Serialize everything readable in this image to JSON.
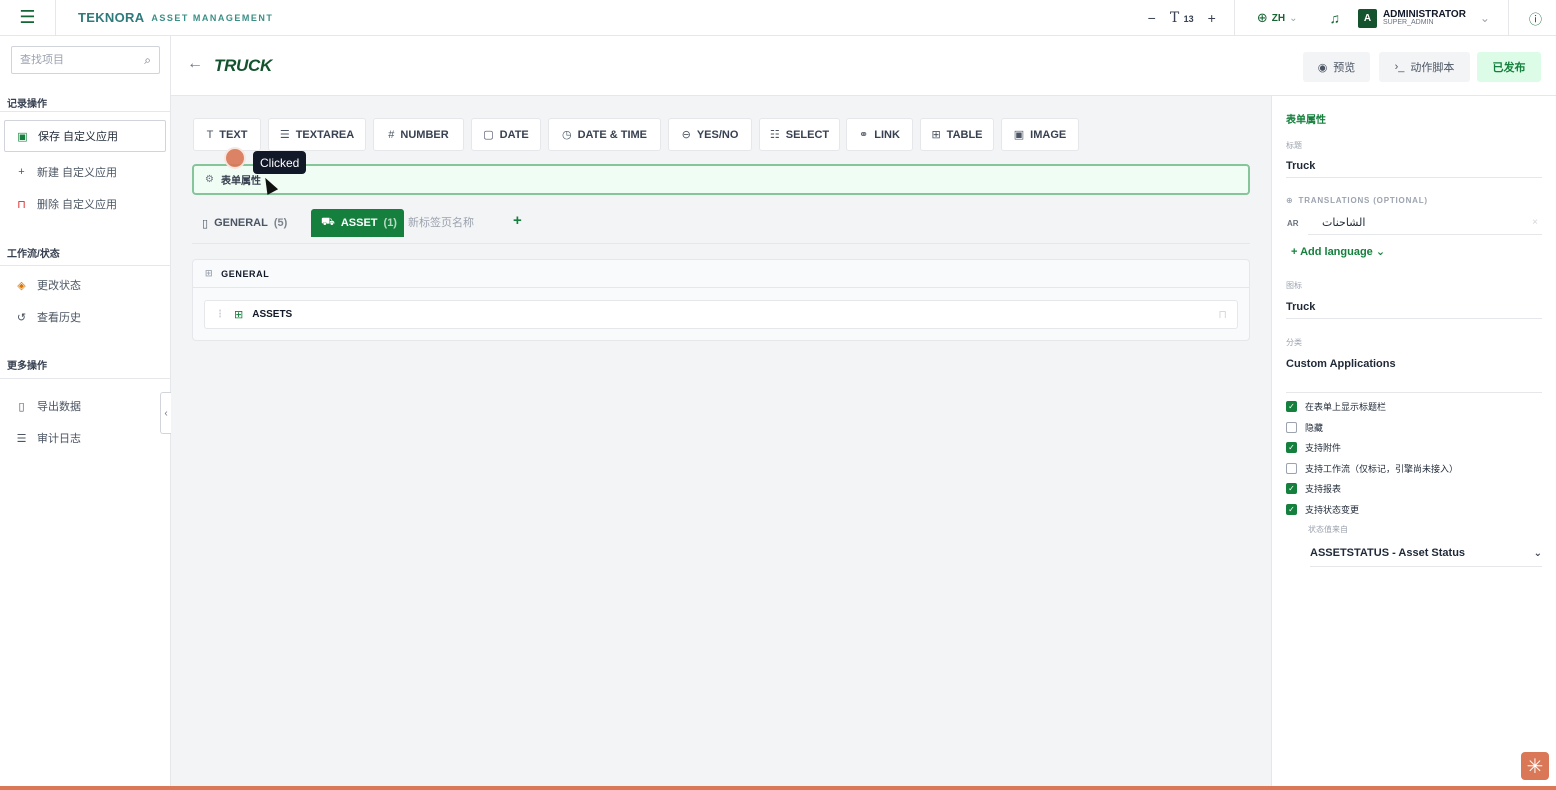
{
  "app": {
    "brand": "TEKNORA",
    "brand_sub": "ASSET MANAGEMENT"
  },
  "topbar": {
    "zoom_minus": "−",
    "zoom_plus": "+",
    "text_size_glyph": "T",
    "text_size_value": "13",
    "language": "ZH",
    "user_initial": "A",
    "user_name": "ADMINISTRATOR",
    "user_role": "SUPER_ADMIN"
  },
  "sidebar": {
    "search_placeholder": "查找项目",
    "sections": [
      {
        "title": "记录操作",
        "items": [
          {
            "label": "保存 自定义应用",
            "icon": "save-icon"
          },
          {
            "label": "新建 自定义应用",
            "icon": "plus-icon"
          },
          {
            "label": "删除 自定义应用",
            "icon": "trash-icon"
          }
        ]
      },
      {
        "title": "工作流/状态",
        "items": [
          {
            "label": "更改状态",
            "icon": "shield-icon"
          },
          {
            "label": "查看历史",
            "icon": "history-icon"
          }
        ]
      },
      {
        "title": "更多操作",
        "items": [
          {
            "label": "导出数据",
            "icon": "document-icon"
          },
          {
            "label": "审计日志",
            "icon": "list-icon"
          }
        ]
      }
    ]
  },
  "page": {
    "title": "TRUCK",
    "preview_label": "预览",
    "action_script_label": "动作脚本",
    "published_label": "已发布"
  },
  "palette": [
    {
      "label": "TEXT",
      "icon": "text-icon",
      "glyph": "T"
    },
    {
      "label": "TEXTAREA",
      "icon": "textarea-icon",
      "glyph": "☰"
    },
    {
      "label": "NUMBER",
      "icon": "hash-icon",
      "glyph": "#"
    },
    {
      "label": "DATE",
      "icon": "calendar-icon",
      "glyph": "▢"
    },
    {
      "label": "DATE & TIME",
      "icon": "clock-icon",
      "glyph": "◷"
    },
    {
      "label": "YES/NO",
      "icon": "toggle-icon",
      "glyph": "⊖"
    },
    {
      "label": "SELECT",
      "icon": "list-icon",
      "glyph": "☷"
    },
    {
      "label": "LINK",
      "icon": "link-icon",
      "glyph": "⚭"
    },
    {
      "label": "TABLE",
      "icon": "table-icon",
      "glyph": "⊞"
    },
    {
      "label": "IMAGE",
      "icon": "image-icon",
      "glyph": "▣"
    }
  ],
  "form_props_bar": {
    "label": "表单属性"
  },
  "tooltip": "Clicked",
  "tabs": {
    "general_label": "GENERAL",
    "general_count": "(5)",
    "asset_label": "ASSET",
    "asset_count": "(1)",
    "new_tab_placeholder": "新标签页名称",
    "add": "+"
  },
  "section": {
    "title": "GENERAL",
    "field_label": "ASSETS"
  },
  "props": {
    "title": "表单属性",
    "title_label": "标题",
    "title_value": "Truck",
    "translations_label": "TRANSLATIONS (OPTIONAL)",
    "ar_code": "AR",
    "ar_value": "الشاحنات",
    "add_language": "+ Add language ⌄",
    "icon_label": "图标",
    "icon_value": "Truck",
    "category_label": "分类",
    "category_value": "Custom Applications",
    "checks": [
      {
        "label": "在表单上显示标题栏",
        "checked": true
      },
      {
        "label": "隐藏",
        "checked": false
      },
      {
        "label": "支持附件",
        "checked": true
      },
      {
        "label": "支持工作流（仅标记，引擎尚未接入）",
        "checked": false
      },
      {
        "label": "支持报表",
        "checked": true
      },
      {
        "label": "支持状态变更",
        "checked": true
      }
    ],
    "status_source_label": "状态值来自",
    "status_source_value": "ASSETSTATUS - Asset Status"
  },
  "colors": {
    "accent": "#15803d",
    "brand": "#2f7a7a",
    "click_marker": "#d97757"
  }
}
